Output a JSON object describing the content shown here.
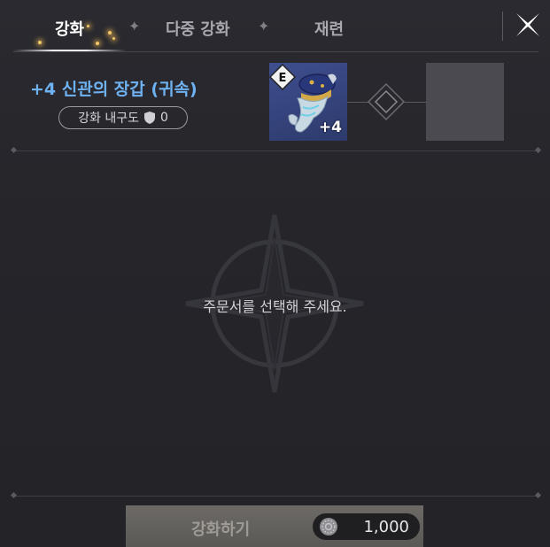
{
  "tabs": [
    {
      "label": "강화",
      "active": true
    },
    {
      "label": "다중 강화",
      "active": false
    },
    {
      "label": "재련",
      "active": false
    }
  ],
  "item": {
    "name": "+4 신관의 장갑 (귀속)",
    "durability_label": "강화 내구도",
    "durability_value": "0",
    "grade": "E",
    "enhance_level": "+4",
    "icon": "gauntlet-icon"
  },
  "result_slot": {
    "icon": "empty-slot"
  },
  "hint": "주문서를 선택해 주세요.",
  "action": {
    "label": "강화하기",
    "cost": "1,000",
    "cost_icon": "coin-icon"
  },
  "colors": {
    "item_name": "#6fb2f2",
    "slot_bg": "#3e4f8f",
    "button_bg": "#6d6a66",
    "background": "#26262b"
  }
}
